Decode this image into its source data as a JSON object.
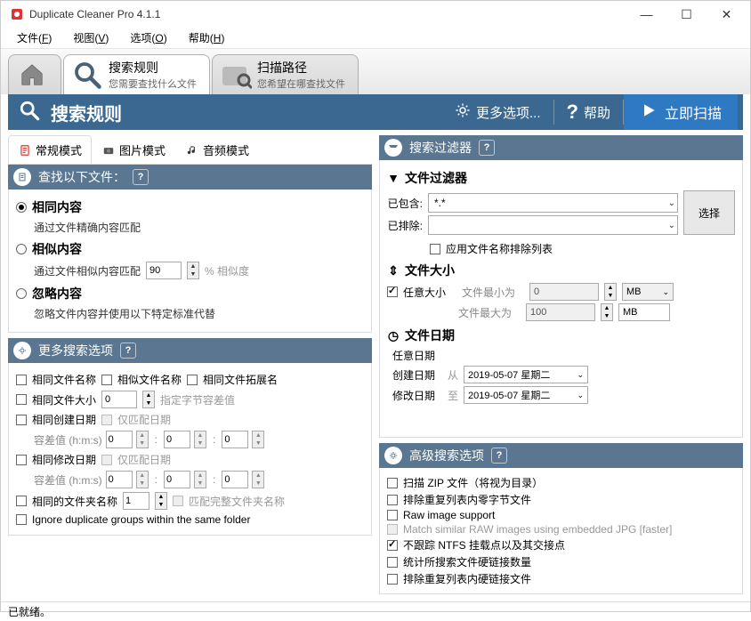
{
  "app": {
    "title": "Duplicate Cleaner Pro 4.1.1"
  },
  "window_buttons": {
    "minimize": "—",
    "maximize": "☐",
    "close": "✕"
  },
  "menu": {
    "file": "文件",
    "file_u": "F",
    "view": "视图",
    "view_u": "V",
    "options": "选项",
    "options_u": "O",
    "help": "帮助",
    "help_u": "H"
  },
  "tabs": {
    "search_rules": {
      "title": "搜索规则",
      "sub": "您需要查找什么文件"
    },
    "scan_path": {
      "title": "扫描路径",
      "sub": "您希望在哪查找文件"
    }
  },
  "header": {
    "title": "搜索规则",
    "more": "更多选项...",
    "help": "帮助",
    "scan": "立即扫描",
    "question": "?"
  },
  "mode_tabs": {
    "regular": "常规模式",
    "image": "图片模式",
    "audio": "音频模式"
  },
  "find_section": {
    "title": "查找以下文件：",
    "same_content": "相同内容",
    "same_content_desc": "通过文件精确内容匹配",
    "similar_content": "相似内容",
    "similar_content_desc": "通过文件相似内容匹配",
    "similarity_value": "90",
    "similarity_suffix": "% 相似度",
    "ignore_content": "忽略内容",
    "ignore_content_desc": "忽略文件内容并使用以下特定标准代替"
  },
  "more_section": {
    "title": "更多搜索选项",
    "same_filename": "相同文件名称",
    "similar_filename": "相似文件名称",
    "same_ext": "相同文件拓展名",
    "same_size": "相同文件大小",
    "size_val": "0",
    "size_placeholder": "指定字节容差值",
    "same_created": "相同创建日期",
    "date_only_1": "仅匹配日期",
    "tolerance_label": "容差值 (h:m:s)",
    "tol_h": "0",
    "tol_m": "0",
    "tol_s": "0",
    "same_modified": "相同修改日期",
    "date_only_2": "仅匹配日期",
    "same_folder": "相同的文件夹名称",
    "folder_val": "1",
    "full_folder": "匹配完整文件夹名称",
    "ignore_groups": "Ignore duplicate groups within the same folder"
  },
  "filter_section": {
    "title": "搜索过滤器",
    "file_filter": "文件过滤器",
    "include": "已包含:",
    "include_value": "*.*",
    "exclude": "已排除:",
    "select_btn": "选择",
    "apply_exclude": "应用文件名称排除列表",
    "file_size": "文件大小",
    "any_size": "任意大小",
    "min": "文件最小为",
    "max": "文件最大为",
    "min_val": "0",
    "max_val": "100",
    "unit": "MB",
    "file_date": "文件日期",
    "any_date": "任意日期",
    "created": "创建日期",
    "modified": "修改日期",
    "from": "从",
    "to": "至",
    "date1": "2019-05-07 星期二",
    "date2": "2019-05-07 星期二"
  },
  "advanced_section": {
    "title": "高级搜索选项",
    "scan_zip": "扫描 ZIP 文件（将视为目录）",
    "exclude_zero": "排除重复列表内零字节文件",
    "raw": "Raw image support",
    "match_raw": "Match similar RAW images using embedded JPG [faster]",
    "no_ntfs": "不跟踪 NTFS 挂载点以及其交接点",
    "count_hardlinks": "统计所搜索文件硬链接数量",
    "exclude_hardlinks": "排除重复列表内硬链接文件"
  },
  "status": "已就绪。",
  "help_q": "?"
}
